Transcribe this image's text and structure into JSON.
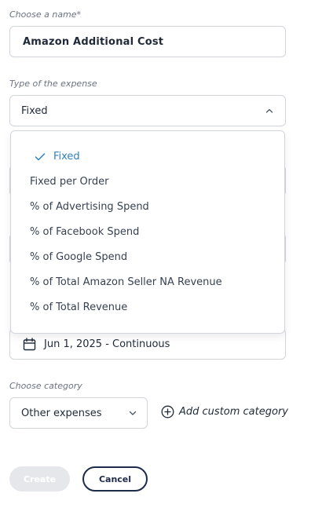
{
  "name_section": {
    "label": "Choose a name*",
    "value": "Amazon Additional Cost"
  },
  "type_section": {
    "label": "Type of the expense",
    "selected": "Fixed",
    "options": [
      "Fixed",
      "Fixed per Order",
      "% of Advertising Spend",
      "% of Facebook Spend",
      "% of Google Spend",
      "% of Total Amazon Seller NA Revenue",
      "% of Total Revenue"
    ]
  },
  "date_section": {
    "value": "Jun 1, 2025 - Continuous"
  },
  "category_section": {
    "label": "Choose category",
    "selected": "Other expenses",
    "add_custom_label": "Add custom category"
  },
  "actions": {
    "create_label": "Create",
    "cancel_label": "Cancel"
  },
  "colors": {
    "accent": "#2f80c0",
    "border": "#d1d5db",
    "cancel_border": "#1e2a4a",
    "disabled": "#e5e7eb"
  },
  "icons": {
    "dropdown_open": "chevron-up-icon",
    "dropdown_closed": "chevron-down-icon",
    "selected": "check-icon",
    "date": "calendar-icon",
    "add": "plus-circle-icon"
  }
}
